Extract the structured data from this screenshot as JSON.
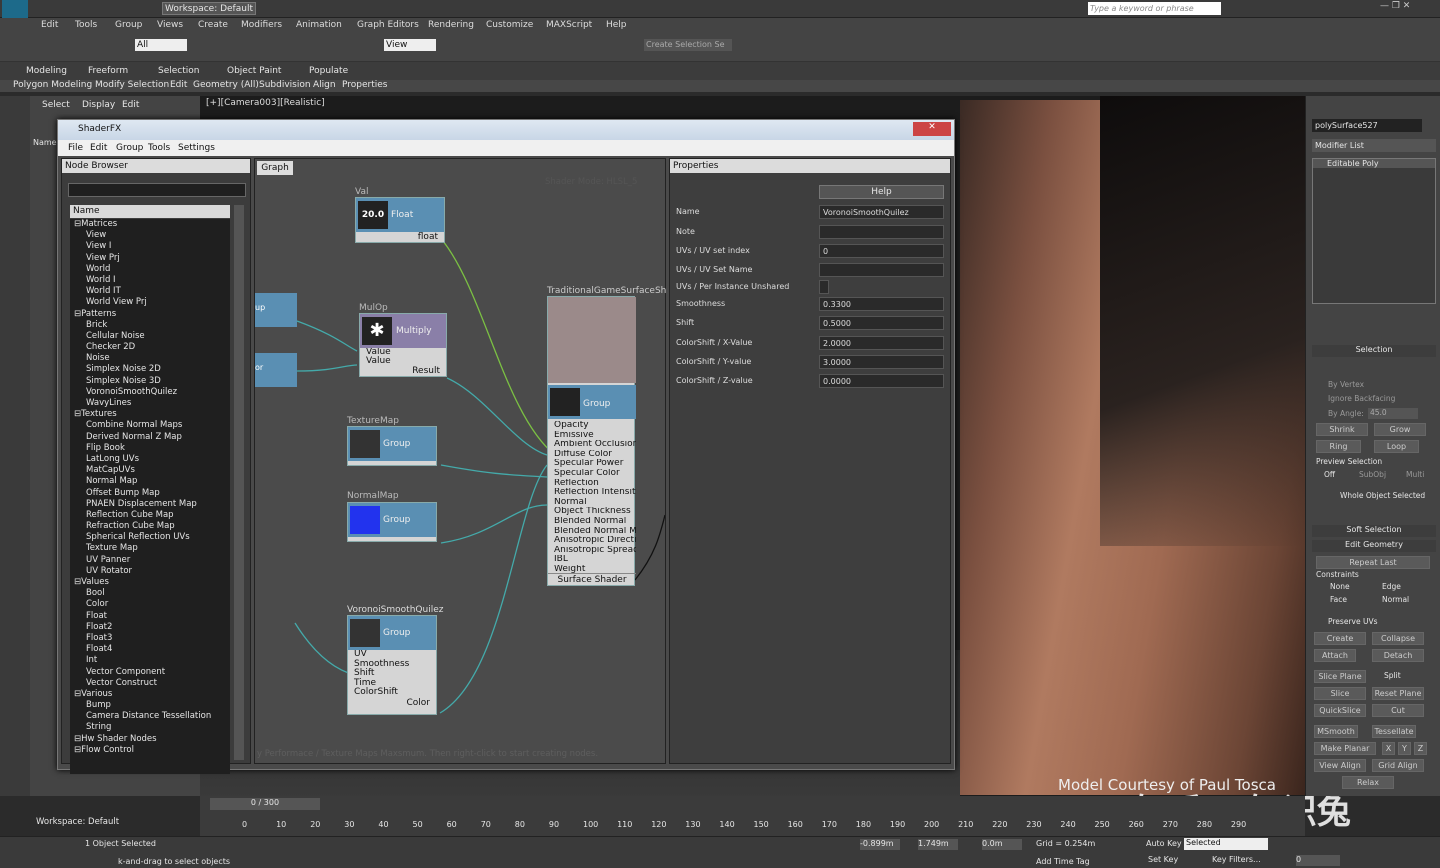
{
  "title": {
    "workspace": "Workspace: Default",
    "search_placeholder": "Type a keyword or phrase"
  },
  "menu": [
    "Edit",
    "Tools",
    "Group",
    "Views",
    "Create",
    "Modifiers",
    "Animation",
    "Graph Editors",
    "Rendering",
    "Customize",
    "MAXScript",
    "Help"
  ],
  "toolbar": {
    "filter": "All",
    "view": "View",
    "create_selection": "Create Selection Se"
  },
  "ribbon": {
    "tabs": [
      "Modeling",
      "Freeform",
      "Selection",
      "Object Paint",
      "Populate"
    ],
    "sub": [
      "Polygon Modeling",
      "Modify Selection",
      "Edit",
      "Geometry (All)",
      "Subdivision",
      "Align",
      "Properties"
    ]
  },
  "scene": {
    "tabs": [
      "Select",
      "Display",
      "Edit"
    ],
    "name_col": "Name"
  },
  "viewport": {
    "label": "[+][Camera003][Realistic]",
    "watermark": "Model Courtesy of Paul Tosca",
    "zhihu": "知乎 @知识兔"
  },
  "shaderfx": {
    "title": "ShaderFX",
    "menu": [
      "File",
      "Edit",
      "Group",
      "Tools",
      "Settings"
    ],
    "node_browser": "Node Browser",
    "graph_tab": "Graph",
    "properties": "Properties",
    "tree_header": "Name",
    "tree": [
      {
        "t": "Matrices",
        "d": 0
      },
      {
        "t": "View",
        "d": 1
      },
      {
        "t": "View I",
        "d": 1
      },
      {
        "t": "View Prj",
        "d": 1
      },
      {
        "t": "World",
        "d": 1
      },
      {
        "t": "World I",
        "d": 1
      },
      {
        "t": "World IT",
        "d": 1
      },
      {
        "t": "World View Prj",
        "d": 1
      },
      {
        "t": "Patterns",
        "d": 0
      },
      {
        "t": "Brick",
        "d": 1
      },
      {
        "t": "Cellular Noise",
        "d": 1
      },
      {
        "t": "Checker 2D",
        "d": 1
      },
      {
        "t": "Noise",
        "d": 1
      },
      {
        "t": "Simplex Noise 2D",
        "d": 1
      },
      {
        "t": "Simplex Noise 3D",
        "d": 1
      },
      {
        "t": "VoronoiSmoothQuilez",
        "d": 1
      },
      {
        "t": "WavyLines",
        "d": 1
      },
      {
        "t": "Textures",
        "d": 0
      },
      {
        "t": "Combine Normal Maps",
        "d": 1
      },
      {
        "t": "Derived Normal Z Map",
        "d": 1
      },
      {
        "t": "Flip Book",
        "d": 1
      },
      {
        "t": "LatLong UVs",
        "d": 1
      },
      {
        "t": "MatCapUVs",
        "d": 1
      },
      {
        "t": "Normal Map",
        "d": 1
      },
      {
        "t": "Offset Bump Map",
        "d": 1
      },
      {
        "t": "PNAEN Displacement Map",
        "d": 1
      },
      {
        "t": "Reflection Cube Map",
        "d": 1
      },
      {
        "t": "Refraction Cube Map",
        "d": 1
      },
      {
        "t": "Spherical Reflection UVs",
        "d": 1
      },
      {
        "t": "Texture Map",
        "d": 1
      },
      {
        "t": "UV Panner",
        "d": 1
      },
      {
        "t": "UV Rotator",
        "d": 1
      },
      {
        "t": "Values",
        "d": 0
      },
      {
        "t": "Bool",
        "d": 1
      },
      {
        "t": "Color",
        "d": 1
      },
      {
        "t": "Float",
        "d": 1
      },
      {
        "t": "Float2",
        "d": 1
      },
      {
        "t": "Float3",
        "d": 1
      },
      {
        "t": "Float4",
        "d": 1
      },
      {
        "t": "Int",
        "d": 1
      },
      {
        "t": "Vector Component",
        "d": 1
      },
      {
        "t": "Vector Construct",
        "d": 1
      },
      {
        "t": "Various",
        "d": 0
      },
      {
        "t": "Bump",
        "d": 1
      },
      {
        "t": "Camera Distance Tessellation",
        "d": 1
      },
      {
        "t": "String",
        "d": 1
      },
      {
        "t": "Hw Shader Nodes",
        "d": 0
      },
      {
        "t": "Flow Control",
        "d": 0
      }
    ],
    "graph": {
      "mode": "Shader Mode: HLSL_5",
      "hint": "y Performace / Texture Maps Maxsmum. Then right-click to start creating nodes.",
      "val": {
        "title": "Val",
        "value": "20.0",
        "type": "Float",
        "out": "float"
      },
      "mulop": {
        "title": "MulOp",
        "name": "Multiply",
        "in": [
          "Value",
          "Value"
        ],
        "out": "Result"
      },
      "texmap": {
        "title": "TextureMap",
        "name": "Group"
      },
      "normalmap": {
        "title": "NormalMap",
        "name": "Group"
      },
      "voronoi": {
        "title": "VoronoiSmoothQuilez",
        "name": "Group",
        "in": [
          "UV",
          "Smoothness",
          "Shift",
          "Time",
          "ColorShift"
        ],
        "out": "Color"
      },
      "surface": {
        "title": "TraditionalGameSurfaceSh",
        "name": "Group",
        "inputs": [
          "Opacity",
          "Emissive",
          "Ambient Occlusion",
          "Diffuse Color",
          "Specular Power",
          "Specular Color",
          "Reflection",
          "Reflection Intensity",
          "Normal",
          "Object Thickness",
          "Blended Normal",
          "Blended Normal Ma",
          "Anisotropic Directio",
          "Anisotropic Spread",
          "IBL",
          "Weight"
        ],
        "out": "Surface Shader"
      },
      "left_stub": [
        "up",
        "or"
      ]
    },
    "props": {
      "help": "Help",
      "rows": [
        {
          "k": "Name",
          "v": "VoronoiSmoothQuilez"
        },
        {
          "k": "Note",
          "v": ""
        },
        {
          "k": "UVs / UV set index",
          "v": "0"
        },
        {
          "k": "UVs / UV Set Name",
          "v": ""
        },
        {
          "k": "UVs / Per Instance Unshared",
          "v": ""
        },
        {
          "k": "Smoothness",
          "v": "0.3300"
        },
        {
          "k": "Shift",
          "v": "0.5000"
        },
        {
          "k": "ColorShift / X-Value",
          "v": "2.0000"
        },
        {
          "k": "ColorShift / Y-value",
          "v": "3.0000"
        },
        {
          "k": "ColorShift / Z-value",
          "v": "0.0000"
        }
      ]
    }
  },
  "cmd": {
    "object": "polySurface527",
    "modlist": "Modifier List",
    "stack": "Editable Poly",
    "selection": "Selection",
    "by_vertex": "By Vertex",
    "ignore_backfacing": "Ignore Backfacing",
    "by_angle": "By Angle:",
    "angle": "45.0",
    "shrink": "Shrink",
    "grow": "Grow",
    "ring": "Ring",
    "loop": "Loop",
    "preview": "Preview Selection",
    "off": "Off",
    "subobj": "SubObj",
    "multi": "Multi",
    "whole": "Whole Object Selected",
    "soft": "Soft Selection",
    "editgeo": "Edit Geometry",
    "repeat": "Repeat Last",
    "constraints": "Constraints",
    "none": "None",
    "edge": "Edge",
    "face": "Face",
    "normal": "Normal",
    "preserve": "Preserve UVs",
    "create": "Create",
    "collapse": "Collapse",
    "attach": "Attach",
    "detach": "Detach",
    "sliceplane": "Slice Plane",
    "split": "Split",
    "slice": "Slice",
    "resetplane": "Reset Plane",
    "quickslice": "QuickSlice",
    "cut": "Cut",
    "msmooth": "MSmooth",
    "tessellate": "Tessellate",
    "makeplanar": "Make Planar",
    "x": "X",
    "y": "Y",
    "z": "Z",
    "viewalign": "View Align",
    "gridalign": "Grid Align",
    "relax": "Relax"
  },
  "timeline": {
    "frame": "0 / 300",
    "ticks": [
      "0",
      "10",
      "20",
      "30",
      "40",
      "50",
      "60",
      "70",
      "80",
      "90",
      "100",
      "110",
      "120",
      "130",
      "140",
      "150",
      "160",
      "170",
      "180",
      "190",
      "200",
      "210",
      "220",
      "230",
      "240",
      "250",
      "260",
      "270",
      "280",
      "290"
    ]
  },
  "status": {
    "workspace": "Workspace: Default",
    "selected": "1 Object Selected",
    "hint": "k-and-drag to select objects",
    "x": "-0.899m",
    "y": "1.749m",
    "z": "0.0m",
    "grid": "Grid = 0.254m",
    "autokey": "Auto Key",
    "setkey": "Set Key",
    "selected_dd": "Selected",
    "keyfilters": "Key Filters...",
    "addtimetag": "Add Time Tag",
    "frame": "0"
  }
}
